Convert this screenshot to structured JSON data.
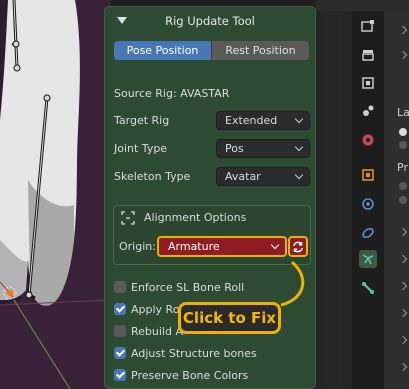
{
  "panel": {
    "title": "Rig Update Tool",
    "tabs": [
      {
        "label": "Pose Position",
        "active": true
      },
      {
        "label": "Rest Position",
        "active": false
      }
    ],
    "source_rig": "Source Rig: AVASTAR",
    "fields": [
      {
        "label": "Target Rig",
        "value": "Extended"
      },
      {
        "label": "Joint Type",
        "value": "Pos"
      },
      {
        "label": "Skeleton Type",
        "value": "Avatar"
      }
    ],
    "alignment": {
      "title": "Alignment Options",
      "origin_label": "Origin:",
      "origin_value": "Armature"
    },
    "checkboxes": [
      {
        "label": "Enforce SL Bone Roll",
        "checked": false
      },
      {
        "label": "Apply Rot",
        "checked": true
      },
      {
        "label": "Rebuild A",
        "checked": false
      },
      {
        "label": "Adjust Structure bones",
        "checked": true
      },
      {
        "label": "Preserve Bone Colors",
        "checked": true
      }
    ]
  },
  "callout": {
    "text": "Click to Fix"
  },
  "properties": {
    "items": [
      "La",
      "Pr"
    ]
  },
  "colors": {
    "panel_bg": "#2d4a33",
    "accent_blue": "#4877b6",
    "warning_red": "#8d1c25",
    "highlight_yellow": "#f0b000"
  }
}
